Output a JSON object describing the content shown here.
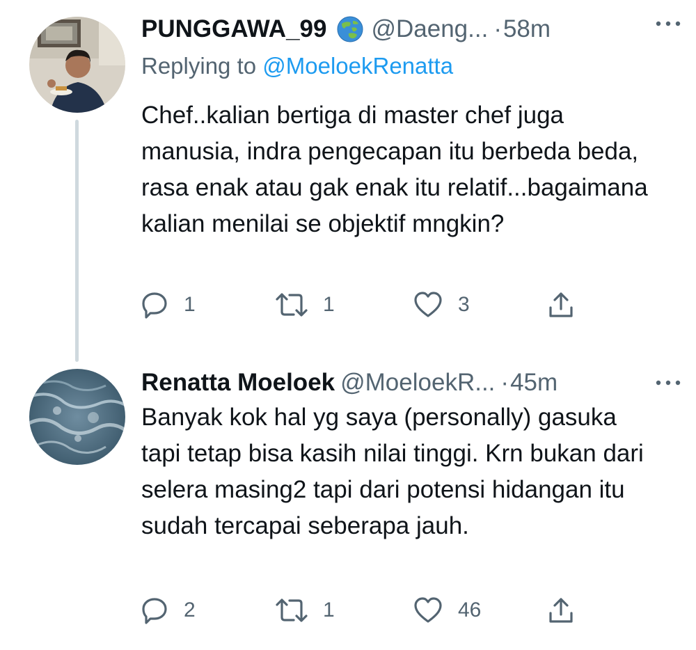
{
  "tweets": [
    {
      "display_name": "PUNGGAWA_99",
      "emoji_icon": "globe-asia-australia-icon",
      "handle": "@Daeng...",
      "separator": "·",
      "time": "58m",
      "replying_prefix": "Replying to ",
      "replying_to": "@MoeloekRenatta",
      "text": "Chef..kalian bertiga di master chef juga manusia, indra pengecapan itu berbeda beda, rasa enak atau gak enak itu relatif...bagaimana kalian menilai se objektif mngkin?",
      "replies": "1",
      "retweets": "1",
      "likes": "3"
    },
    {
      "display_name": "Renatta Moeloek",
      "handle": "@MoeloekR...",
      "separator": "·",
      "time": "45m",
      "text": "Banyak kok hal yg saya (personally) gasuka tapi tetap bisa kasih nilai tinggi. Krn bukan dari selera masing2 tapi dari potensi hidangan itu sudah tercapai seberapa jauh.",
      "replies": "2",
      "retweets": "1",
      "likes": "46"
    }
  ],
  "colors": {
    "text": "#0f1419",
    "secondary": "#536471",
    "link": "#1d9bf0",
    "thread_line": "#cfd9de"
  },
  "icons": {
    "reply": "speech-bubble-icon",
    "retweet": "retweet-icon",
    "like": "heart-icon",
    "share": "share-icon",
    "more": "more-horizontal-icon"
  }
}
